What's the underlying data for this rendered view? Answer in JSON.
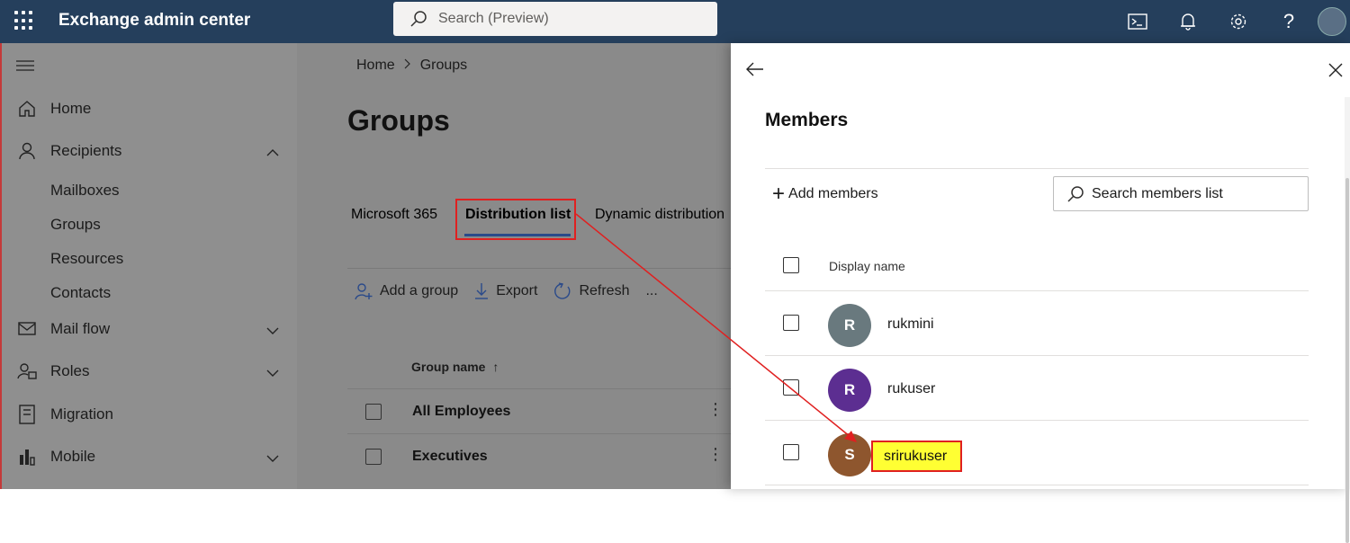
{
  "topbar": {
    "app_title": "Exchange admin center",
    "search_placeholder": "Search (Preview)",
    "icons": [
      "app-launcher-icon",
      "cloud-shell-icon",
      "notifications-icon",
      "settings-icon",
      "help-icon",
      "user-avatar"
    ]
  },
  "sidebar": {
    "items": [
      {
        "label": "Home",
        "icon": "home-icon"
      },
      {
        "label": "Recipients",
        "icon": "person-icon",
        "expanded": true
      },
      {
        "label": "Mail flow",
        "icon": "mail-icon",
        "expanded": false
      },
      {
        "label": "Roles",
        "icon": "roles-icon",
        "expanded": false
      },
      {
        "label": "Migration",
        "icon": "migration-icon"
      },
      {
        "label": "Mobile",
        "icon": "mobile-icon",
        "expanded": false
      }
    ],
    "recipients_sub": [
      "Mailboxes",
      "Groups",
      "Resources",
      "Contacts"
    ]
  },
  "main": {
    "breadcrumb": [
      "Home",
      "Groups"
    ],
    "title": "Groups",
    "tabs": [
      {
        "label": "Microsoft 365",
        "active": false
      },
      {
        "label": "Distribution list",
        "active": true
      },
      {
        "label": "Dynamic distribution",
        "active": false
      }
    ],
    "commands": {
      "add": "Add a group",
      "export": "Export",
      "refresh": "Refresh",
      "more": "..."
    },
    "column_header": "Group name",
    "sort_indicator": "↑",
    "rows": [
      "All Employees",
      "Executives"
    ]
  },
  "panel": {
    "title": "Members",
    "add_members": "Add members",
    "search_placeholder": "Search members list",
    "column_header": "Display name",
    "members": [
      {
        "initial": "R",
        "name": "rukmini",
        "color": "#69797e"
      },
      {
        "initial": "R",
        "name": "rukuser",
        "color": "#5c2e91"
      },
      {
        "initial": "S",
        "name": "srirukuser",
        "color": "#8e562e",
        "highlighted": true
      }
    ]
  },
  "annotation": {
    "highlight_color": "#ffff33",
    "box_color": "#e02020"
  }
}
